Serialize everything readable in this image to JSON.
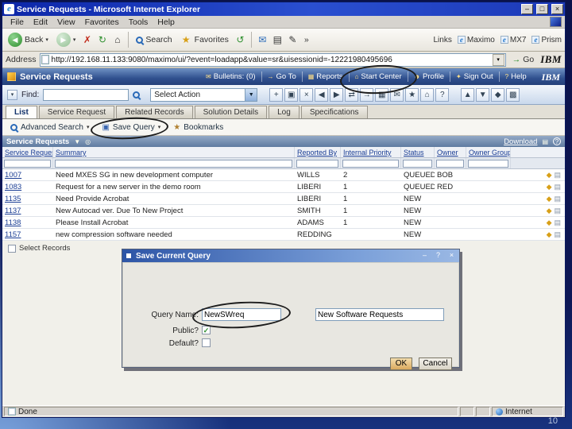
{
  "slide": {
    "page_number": "10"
  },
  "colors": {
    "titlebar_blue": "#0c26a8",
    "maximo_header_blue": "#30508e",
    "link_blue": "#1a3d94",
    "annotation_black": "#1c1c1c"
  },
  "browser": {
    "title": "Service Requests - Microsoft Internet Explorer",
    "menu": [
      "File",
      "Edit",
      "View",
      "Favorites",
      "Tools",
      "Help"
    ],
    "toolbar": {
      "back_label": "Back",
      "search_label": "Search",
      "favorites_label": "Favorites",
      "overflow_label": "»",
      "links_label": "Links",
      "links": [
        "Maximo",
        "MX7",
        "Prism"
      ]
    },
    "address": {
      "label": "Address",
      "url": "http://192.168.11.133:9080/maximo/ui/?event=loadapp&value=sr&uisessionid=-12221980495696",
      "go_label": "Go"
    },
    "brand": "IBM",
    "status": {
      "done": "Done",
      "zone": "Internet"
    }
  },
  "app": {
    "title": "Service Requests",
    "brand": "IBM",
    "nav": [
      {
        "label": "Bulletins: (0)"
      },
      {
        "label": "Go To"
      },
      {
        "label": "Reports"
      },
      {
        "label": "Start Center"
      },
      {
        "label": "Profile"
      },
      {
        "label": "Sign Out"
      },
      {
        "label": "Help"
      }
    ],
    "find_label": "Find:",
    "select_action_label": "Select Action",
    "toolbar_icons": [
      {
        "name": "insert-new-record-icon",
        "glyph": "+"
      },
      {
        "name": "save-record-icon",
        "glyph": "▣"
      },
      {
        "name": "clear-changes-icon",
        "glyph": "×"
      },
      {
        "name": "previous-record-icon",
        "glyph": "◀"
      },
      {
        "name": "next-record-icon",
        "glyph": "▶"
      },
      {
        "name": "change-status-icon",
        "glyph": "⇄"
      },
      {
        "name": "route-workflow-icon",
        "glyph": "→"
      },
      {
        "name": "reports-icon",
        "glyph": "▦"
      },
      {
        "name": "attachments-icon",
        "glyph": "✉"
      },
      {
        "name": "bookmark-icon",
        "glyph": "★"
      },
      {
        "name": "start-center-icon",
        "glyph": "⌂"
      },
      {
        "name": "help-icon",
        "glyph": "?"
      }
    ],
    "toolbar_icons_2": [
      {
        "name": "previous-page-icon",
        "glyph": "▲"
      },
      {
        "name": "next-page-icon",
        "glyph": "▼"
      },
      {
        "name": "flag-icon",
        "glyph": "◆"
      },
      {
        "name": "grid-icon",
        "glyph": "▩"
      }
    ],
    "tabs": [
      "List",
      "Service Request",
      "Related Records",
      "Solution Details",
      "Log",
      "Specifications"
    ],
    "actions": {
      "advanced_search_label": "Advanced Search",
      "save_query_label": "Save Query",
      "bookmarks_label": "Bookmarks"
    },
    "table": {
      "title": "Service Requests",
      "download_label": "Download",
      "columns": [
        "Service Request",
        "Summary",
        "Reported By",
        "Internal Priority",
        "Status",
        "Owner",
        "Owner Group"
      ],
      "rows": [
        {
          "id": "1007",
          "summary": "Need MXES SG in new development computer",
          "reported_by": "WILLS",
          "priority": "2",
          "status": "QUEUED",
          "owner": "BOB",
          "owner_group": ""
        },
        {
          "id": "1083",
          "summary": "Request for a new server in the demo room",
          "reported_by": "LIBERI",
          "priority": "1",
          "status": "QUEUED",
          "owner": "RED",
          "owner_group": ""
        },
        {
          "id": "1135",
          "summary": "Need Provide Acrobat",
          "reported_by": "LIBERI",
          "priority": "1",
          "status": "NEW",
          "owner": "",
          "owner_group": ""
        },
        {
          "id": "1137",
          "summary": "New Autocad ver. Due To New Project",
          "reported_by": "SMITH",
          "priority": "1",
          "status": "NEW",
          "owner": "",
          "owner_group": ""
        },
        {
          "id": "1138",
          "summary": "Please Install Acrobat",
          "reported_by": "ADAMS",
          "priority": "1",
          "status": "NEW",
          "owner": "",
          "owner_group": ""
        },
        {
          "id": "1157",
          "summary": "new compression software needed",
          "reported_by": "REDDING",
          "priority": "",
          "status": "NEW",
          "owner": "",
          "owner_group": ""
        }
      ],
      "select_records_label": "Select Records"
    }
  },
  "dialog": {
    "title": "Save Current Query",
    "query_name_label": "Query Name:",
    "query_name_value": "NewSWreq",
    "description_value": "New Software Requests",
    "public_label": "Public?",
    "public_checked": "✓",
    "default_label": "Default?",
    "default_checked": "",
    "ok_label": "OK",
    "cancel_label": "Cancel"
  }
}
